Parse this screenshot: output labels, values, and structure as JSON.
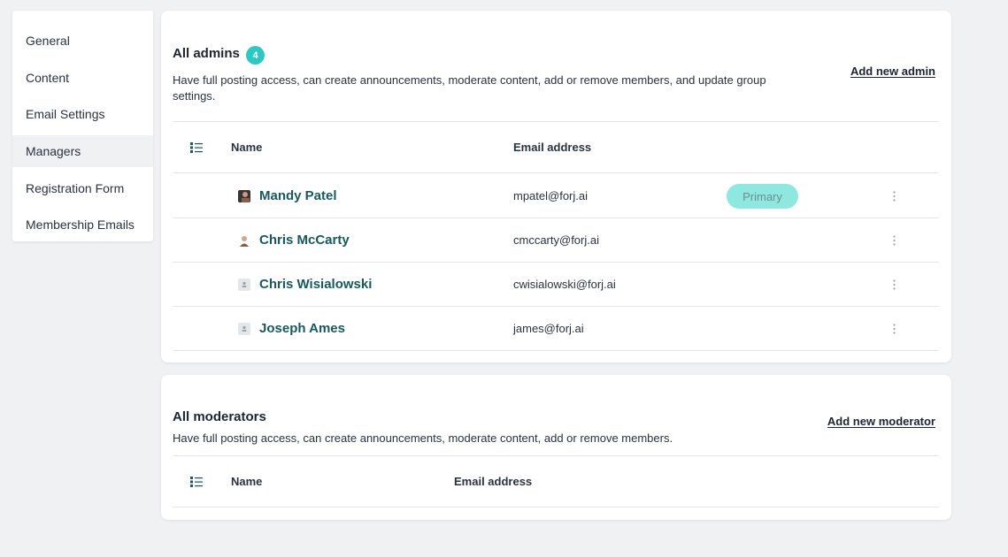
{
  "sidebar": {
    "items": [
      {
        "label": "General",
        "active": false
      },
      {
        "label": "Content",
        "active": false
      },
      {
        "label": "Email Settings",
        "active": false
      },
      {
        "label": "Managers",
        "active": true
      },
      {
        "label": "Registration Form",
        "active": false
      },
      {
        "label": "Membership Emails",
        "active": false
      }
    ]
  },
  "admins": {
    "title": "All admins",
    "count": "4",
    "description": "Have full posting access, can create announcements, moderate content, add or remove members, and update group settings.",
    "add_label": "Add new admin",
    "columns": {
      "name": "Name",
      "email": "Email address"
    },
    "rows": [
      {
        "name": "Mandy Patel",
        "email": "mpatel@forj.ai",
        "badge": "Primary",
        "avatar": "photo-avatar-icon"
      },
      {
        "name": "Chris McCarty",
        "email": "cmccarty@forj.ai",
        "badge": "",
        "avatar": "photo-avatar-icon"
      },
      {
        "name": "Chris Wisialowski",
        "email": "cwisialowski@forj.ai",
        "badge": "",
        "avatar": "default-avatar-icon"
      },
      {
        "name": "Joseph Ames",
        "email": "james@forj.ai",
        "badge": "",
        "avatar": "default-avatar-icon"
      }
    ]
  },
  "moderators": {
    "title": "All moderators",
    "description": "Have full posting access, can create announcements, moderate content, add or remove members.",
    "add_label": "Add new moderator",
    "columns": {
      "name": "Name",
      "email": "Email address"
    }
  },
  "colors": {
    "accent": "#2ec8c3",
    "name_link": "#17595e",
    "primary_pill": "#8ee8e0"
  }
}
